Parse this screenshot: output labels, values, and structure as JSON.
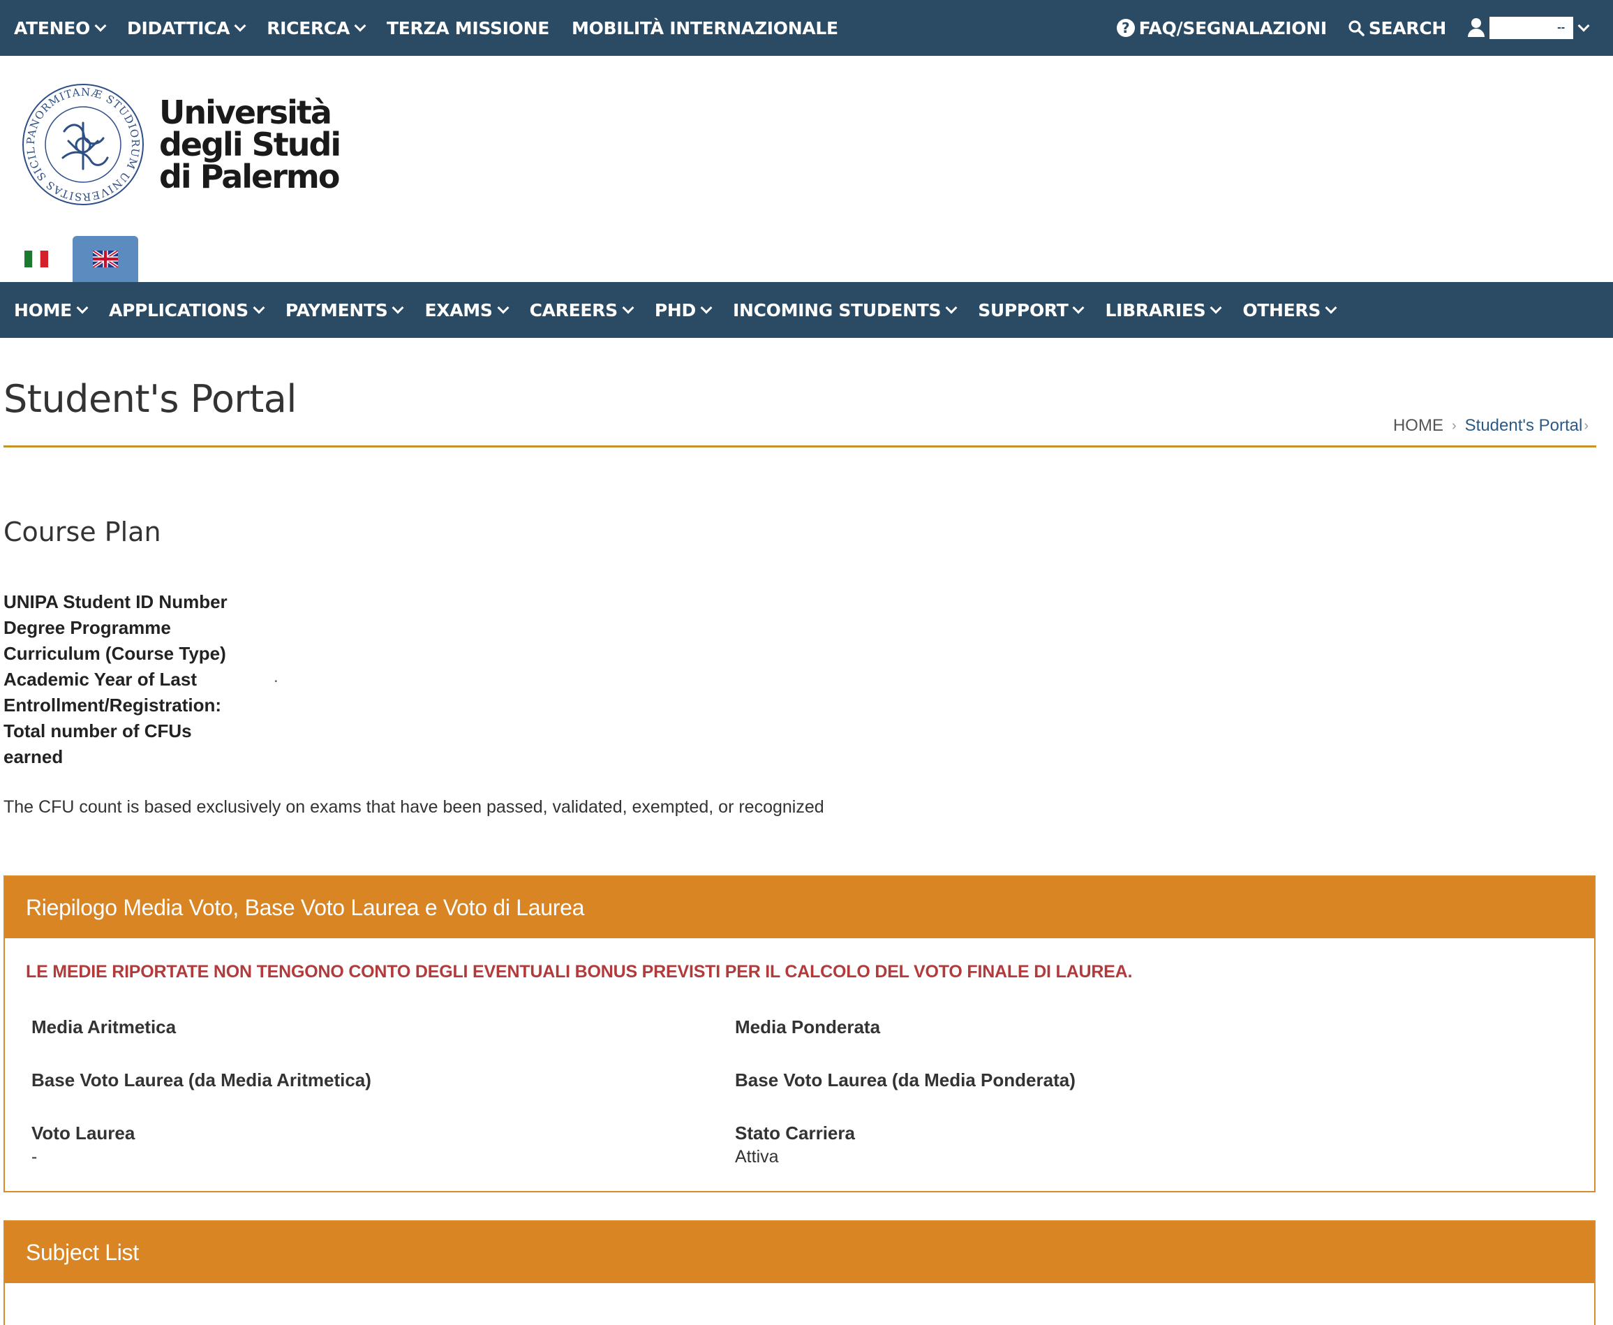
{
  "topbar": {
    "items": [
      {
        "label": "ATENEO",
        "dropdown": true
      },
      {
        "label": "DIDATTICA",
        "dropdown": true
      },
      {
        "label": "RICERCA",
        "dropdown": true
      },
      {
        "label": "TERZA MISSIONE",
        "dropdown": false
      },
      {
        "label": "MOBILITÀ INTERNAZIONALE",
        "dropdown": false
      }
    ],
    "faq_label": "FAQ/SEGNALAZIONI",
    "search_label": "SEARCH",
    "user_value": "--"
  },
  "university": {
    "line1": "Università",
    "line2": "degli Studi",
    "line3": "di Palermo",
    "seal_text": "PANORMITANÆ STUDIORUM UNIVERSITAS SICILIÆ"
  },
  "main_nav": {
    "items": [
      {
        "label": "HOME"
      },
      {
        "label": "APPLICATIONS"
      },
      {
        "label": "PAYMENTS"
      },
      {
        "label": "EXAMS"
      },
      {
        "label": "CAREERS"
      },
      {
        "label": "PHD"
      },
      {
        "label": "INCOMING STUDENTS"
      },
      {
        "label": "SUPPORT"
      },
      {
        "label": "LIBRARIES"
      },
      {
        "label": "OTHERS"
      }
    ]
  },
  "page": {
    "title": "Student's Portal",
    "breadcrumb": {
      "home": "HOME",
      "current": "Student's Portal"
    }
  },
  "course_plan": {
    "title": "Course Plan",
    "fields": [
      "UNIPA Student ID Number",
      "Degree Programme",
      "Curriculum (Course Type)",
      "Academic Year of Last Entrollment/Registration:",
      "Total number of CFUs earned"
    ],
    "stray_dot": ".",
    "note": "The CFU count is based exclusively on exams that have been passed, validated, exempted, or recognized"
  },
  "summary_panel": {
    "title": "Riepilogo Media Voto, Base Voto Laurea e Voto di Laurea",
    "warning": "LE MEDIE RIPORTATE NON TENGONO CONTO DEGLI EVENTUALI BONUS PREVISTI PER IL CALCOLO DEL VOTO FINALE DI LAUREA.",
    "media_aritmetica": {
      "label": "Media Aritmetica",
      "value": ""
    },
    "media_ponderata": {
      "label": "Media Ponderata",
      "value": ""
    },
    "base_aritmetica": {
      "label": "Base Voto Laurea (da Media Aritmetica)",
      "value": ""
    },
    "base_ponderata": {
      "label": "Base Voto Laurea (da Media Ponderata)",
      "value": ""
    },
    "voto_laurea": {
      "label": "Voto Laurea",
      "value": "-"
    },
    "stato_carriera": {
      "label": "Stato Carriera",
      "value": "Attiva"
    }
  },
  "subject_panel": {
    "title": "Subject List"
  },
  "colors": {
    "navy": "#2b4a63",
    "orange": "#d98524",
    "gold_rule": "#c8922a",
    "warning_red": "#b23a3a",
    "lang_active": "#5b8bbf"
  }
}
